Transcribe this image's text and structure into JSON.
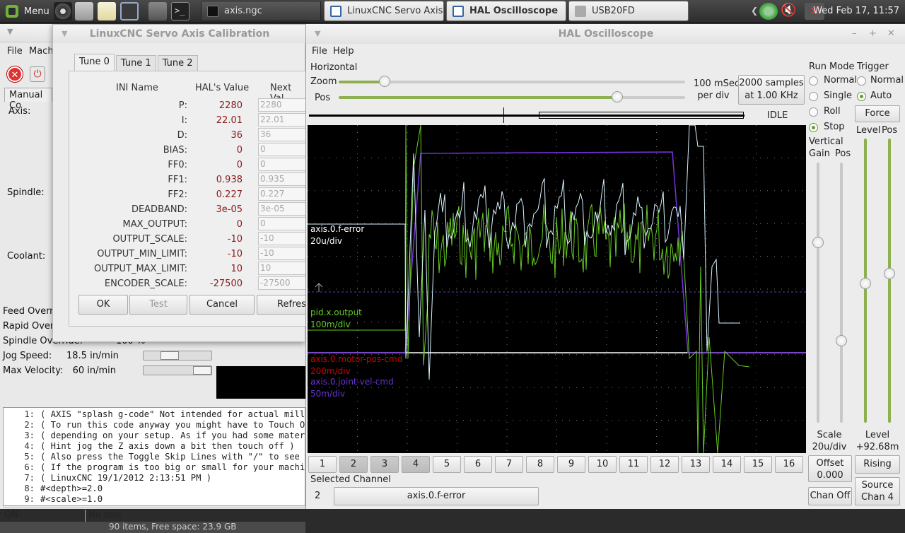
{
  "taskbar": {
    "menu_label": "Menu",
    "tasks": [
      {
        "label": "axis.ngc"
      },
      {
        "label": "LinuxCNC Servo Axis ..."
      },
      {
        "label": "HAL Oscilloscope"
      },
      {
        "label": "USB20FD"
      }
    ],
    "clock": "Wed Feb 17, 11:57"
  },
  "axis": {
    "menu": [
      "File",
      "Mach"
    ],
    "tab_label": "Manual Co",
    "labels": {
      "axis": "Axis:",
      "spindle": "Spindle:",
      "coolant": "Coolant:"
    },
    "rows": [
      {
        "label": "Feed Overr",
        "value": ""
      },
      {
        "label": "Rapid Over",
        "value": ""
      },
      {
        "label": "Spindle Override:",
        "value": "100 %"
      },
      {
        "label": "Jog Speed:",
        "value": "18.5 in/min"
      },
      {
        "label": "Max Velocity:",
        "value": "60 in/min"
      }
    ],
    "gcode": [
      {
        "n": "1:",
        "t": "( AXIS \"splash g-code\" Not intended for actual millin"
      },
      {
        "n": "2:",
        "t": "( To run this code anyway you might have to Touch Off"
      },
      {
        "n": "3:",
        "t": "( depending on your setup. As if you had some materia"
      },
      {
        "n": "4:",
        "t": "( Hint jog the Z axis down a bit then touch off )"
      },
      {
        "n": "5:",
        "t": "( Also press the Toggle Skip Lines with \"/\" to see th"
      },
      {
        "n": "6:",
        "t": "( If the program is too big or small for your machine"
      },
      {
        "n": "7:",
        "t": "( LinuxCNC 19/1/2012 2:13:51 PM )"
      },
      {
        "n": "8:",
        "t": "#<depth>=2.0"
      },
      {
        "n": "9:",
        "t": "#<scale>=1.0"
      }
    ],
    "status_state": "ON",
    "status_tool": "No tool",
    "bottom_text": "90 items, Free space: 23.9 GB"
  },
  "calib": {
    "title": "LinuxCNC Servo Axis Calibration",
    "tabs": [
      "Tune 0",
      "Tune 1",
      "Tune 2"
    ],
    "headers": {
      "ini": "INI Name",
      "hal": "HAL's Value",
      "next": "Next Val"
    },
    "rows": [
      {
        "name": "P:",
        "hal": "2280",
        "next": "2280"
      },
      {
        "name": "I:",
        "hal": "22.01",
        "next": "22.01"
      },
      {
        "name": "D:",
        "hal": "36",
        "next": "36"
      },
      {
        "name": "BIAS:",
        "hal": "0",
        "next": "0"
      },
      {
        "name": "FF0:",
        "hal": "0",
        "next": "0"
      },
      {
        "name": "FF1:",
        "hal": "0.938",
        "next": "0.935"
      },
      {
        "name": "FF2:",
        "hal": "0.227",
        "next": "0.227"
      },
      {
        "name": "DEADBAND:",
        "hal": "3e-05",
        "next": "3e-05"
      },
      {
        "name": "MAX_OUTPUT:",
        "hal": "0",
        "next": "0"
      },
      {
        "name": "OUTPUT_SCALE:",
        "hal": "-10",
        "next": "-10"
      },
      {
        "name": "OUTPUT_MIN_LIMIT:",
        "hal": "-10",
        "next": "-10"
      },
      {
        "name": "OUTPUT_MAX_LIMIT:",
        "hal": "10",
        "next": "10"
      },
      {
        "name": "ENCODER_SCALE:",
        "hal": "-27500",
        "next": "-27500"
      }
    ],
    "buttons": {
      "ok": "OK",
      "test": "Test",
      "cancel": "Cancel",
      "refresh": "Refresh"
    }
  },
  "scope": {
    "title": "HAL Oscilloscope",
    "menu": [
      "File",
      "Help"
    ],
    "horizontal": "Horizontal",
    "zoom_label": "Zoom",
    "pos_label": "Pos",
    "rate_line1": "100 mSec",
    "rate_line2": "per div",
    "samples_line1": "2000 samples",
    "samples_line2": "at 1.00 KHz",
    "state": "IDLE",
    "run_mode": {
      "title": "Run Mode",
      "options": [
        "Normal",
        "Single",
        "Roll",
        "Stop"
      ],
      "selected": "Stop"
    },
    "trigger": {
      "title": "Trigger",
      "options": [
        "Normal",
        "Auto"
      ],
      "selected": "Auto",
      "force": "Force",
      "level": "Level",
      "pos": "Pos"
    },
    "vertical": {
      "title": "Vertical",
      "gain": "Gain",
      "pos": "Pos"
    },
    "channel_labels": [
      {
        "name": "axis.0.f-error",
        "scale": "20u/div",
        "color": "#ffffff"
      },
      {
        "name": "pid.x.output",
        "scale": "100m/div",
        "color": "#66cc22"
      },
      {
        "name": "axis.0.motor-pos-cmd",
        "scale": "200m/div",
        "color": "#cc0000"
      },
      {
        "name": "axis.0.joint-vel-cmd",
        "scale": "50m/div",
        "color": "#6633cc"
      }
    ],
    "channels": [
      "1",
      "2",
      "3",
      "4",
      "5",
      "6",
      "7",
      "8",
      "9",
      "10",
      "11",
      "12",
      "13",
      "14",
      "15",
      "16"
    ],
    "selected_channel_label": "Selected Channel",
    "selected_channel_num": "2",
    "selected_channel_name": "axis.0.f-error",
    "scale_label": "Scale",
    "scale_value": "20u/div",
    "level_label": "Level",
    "level_value": "+92.68m",
    "offset_label": "Offset",
    "offset_value": "0.000",
    "rising": "Rising",
    "chan_off": "Chan Off",
    "source_line1": "Source",
    "source_line2": "Chan 4"
  }
}
